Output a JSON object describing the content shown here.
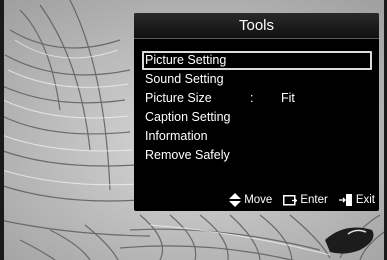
{
  "menu": {
    "title": "Tools",
    "items": [
      {
        "label": "Picture Setting",
        "separator": "",
        "value": ""
      },
      {
        "label": "Sound Setting",
        "separator": "",
        "value": ""
      },
      {
        "label": "Picture Size",
        "separator": ":",
        "value": "Fit"
      },
      {
        "label": "Caption Setting",
        "separator": "",
        "value": ""
      },
      {
        "label": "Information",
        "separator": "",
        "value": ""
      },
      {
        "label": "Remove Safely",
        "separator": "",
        "value": ""
      }
    ],
    "selected_index": 0
  },
  "footer": {
    "move_icon": "up-down-arrow-icon",
    "move_label": "Move",
    "enter_icon": "enter-icon",
    "enter_label": "Enter",
    "exit_icon": "exit-door-icon",
    "exit_label": "Exit"
  },
  "colors": {
    "menu_background": "#000000",
    "menu_text": "#ffffff",
    "selection_border": "#dcdcdc",
    "backdrop": "#bdbdbd"
  }
}
